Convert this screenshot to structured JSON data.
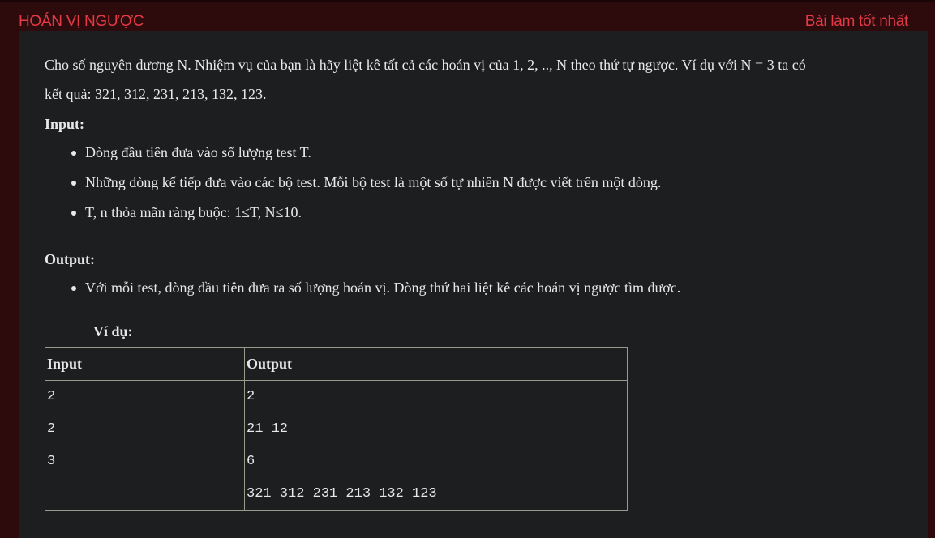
{
  "header": {
    "title": "HOÁN VỊ NGƯỢC",
    "best_link": "Bài làm tốt nhất"
  },
  "problem": {
    "statement_line1": "Cho số nguyên dương N. Nhiệm vụ của bạn là hãy liệt kê tất cả các hoán vị của 1, 2, .., N theo thứ tự ngược. Ví dụ với N = 3 ta có",
    "statement_line2": "kết quả: 321, 312, 231, 213, 132, 123.",
    "input_heading": "Input:",
    "input_items": [
      "Dòng đầu tiên đưa vào số lượng test T.",
      "Những dòng kế tiếp đưa vào các bộ test. Mỗi bộ test là một số tự nhiên N được viết trên một dòng.",
      "T, n thỏa mãn ràng buộc: 1≤T, N≤10."
    ],
    "output_heading": "Output:",
    "output_items": [
      "Với mỗi test, dòng đầu tiên đưa ra số lượng hoán vị. Dòng thứ hai liệt kê các hoán vị ngược tìm được."
    ],
    "example_label": "Ví dụ:"
  },
  "example_table": {
    "headers": [
      "Input",
      "Output"
    ],
    "rows": [
      [
        "2",
        "2"
      ],
      [
        "2",
        "21 12"
      ],
      [
        "3",
        "6"
      ],
      [
        "",
        "321 312 231 213 132 123"
      ]
    ]
  },
  "colors": {
    "accent": "#e23a46",
    "frame": "#2d0b0d",
    "panel": "#1c1e20",
    "text": "#e8e8e8"
  }
}
